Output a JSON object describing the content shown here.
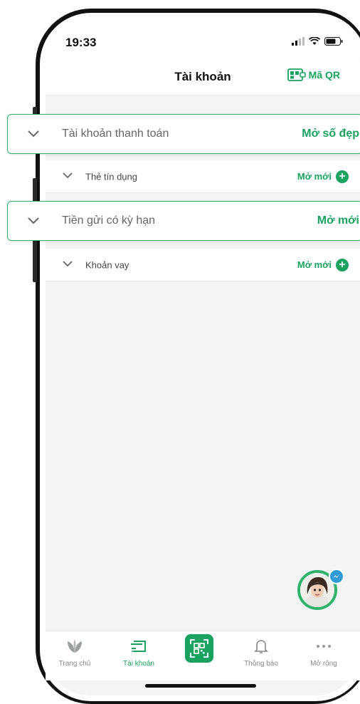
{
  "status": {
    "time": "19:33"
  },
  "header": {
    "title": "Tài khoản",
    "qr_label": "Mã QR"
  },
  "cards": [
    {
      "label": "Tài khoản thanh toán",
      "action": "Mở số đẹp"
    },
    {
      "label": "Tiền gửi có kỳ hạn",
      "action": "Mở mới"
    }
  ],
  "rows": [
    {
      "label": "Thẻ tín dụng",
      "action": "Mở mới"
    },
    {
      "label": "Khoản vay",
      "action": "Mở mới"
    }
  ],
  "nav": [
    {
      "label": "Trang chủ",
      "icon": "home-leaf-icon"
    },
    {
      "label": "Tài khoản",
      "icon": "wallet-icon"
    },
    {
      "label": "",
      "icon": "qr-scan-icon"
    },
    {
      "label": "Thông báo",
      "icon": "bell-icon"
    },
    {
      "label": "Mở rộng",
      "icon": "more-dots-icon"
    }
  ],
  "colors": {
    "brand": "#1aa260",
    "card_border": "#2fb36c",
    "background": "#f3f5f5"
  }
}
